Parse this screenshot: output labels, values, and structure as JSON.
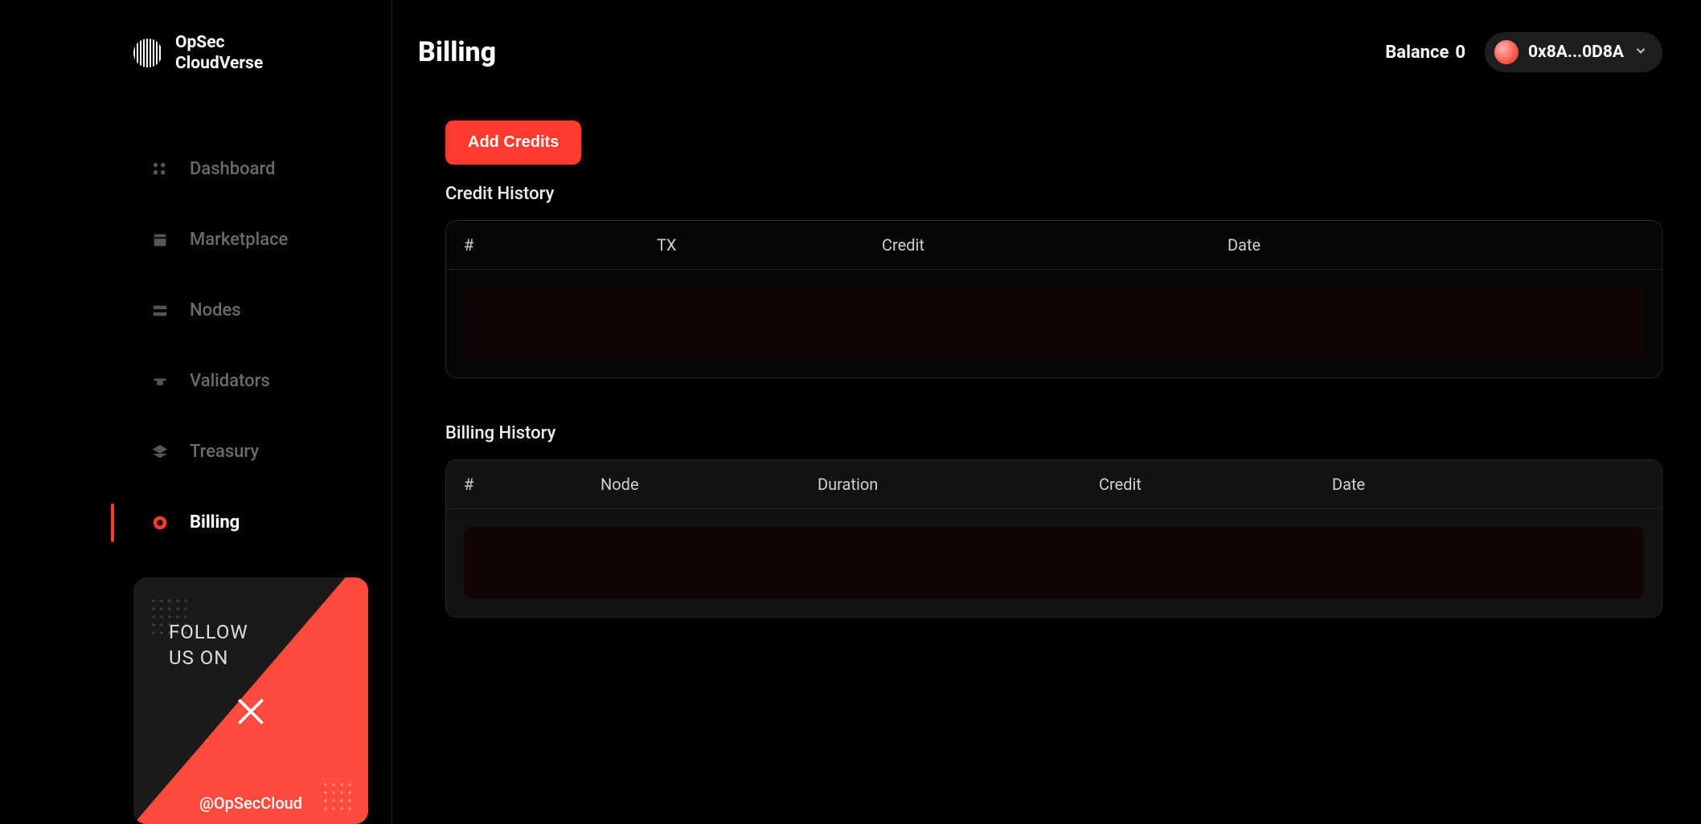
{
  "brand": {
    "line1": "OpSec",
    "line2": "CloudVerse"
  },
  "sidebar": {
    "items": [
      {
        "label": "Dashboard",
        "icon": "dashboard-icon",
        "active": false
      },
      {
        "label": "Marketplace",
        "icon": "marketplace-icon",
        "active": false
      },
      {
        "label": "Nodes",
        "icon": "nodes-icon",
        "active": false
      },
      {
        "label": "Validators",
        "icon": "validators-icon",
        "active": false
      },
      {
        "label": "Treasury",
        "icon": "treasury-icon",
        "active": false
      },
      {
        "label": "Billing",
        "icon": "billing-icon",
        "active": true
      }
    ]
  },
  "promo": {
    "line1": "FOLLOW",
    "line2": "US ON",
    "handle": "@OpSecCloud"
  },
  "header": {
    "title": "Billing",
    "balance_label": "Balance",
    "balance_value": "0",
    "wallet_address": "0x8A...0D8A"
  },
  "actions": {
    "add_credits": "Add Credits"
  },
  "credit_history": {
    "title": "Credit History",
    "columns": {
      "idx": "#",
      "tx": "TX",
      "credit": "Credit",
      "date": "Date"
    },
    "rows": []
  },
  "billing_history": {
    "title": "Billing History",
    "columns": {
      "idx": "#",
      "node": "Node",
      "duration": "Duration",
      "credit": "Credit",
      "date": "Date"
    },
    "rows": []
  },
  "colors": {
    "accent": "#ff3b30",
    "bg": "#000000",
    "card": "#121212"
  }
}
